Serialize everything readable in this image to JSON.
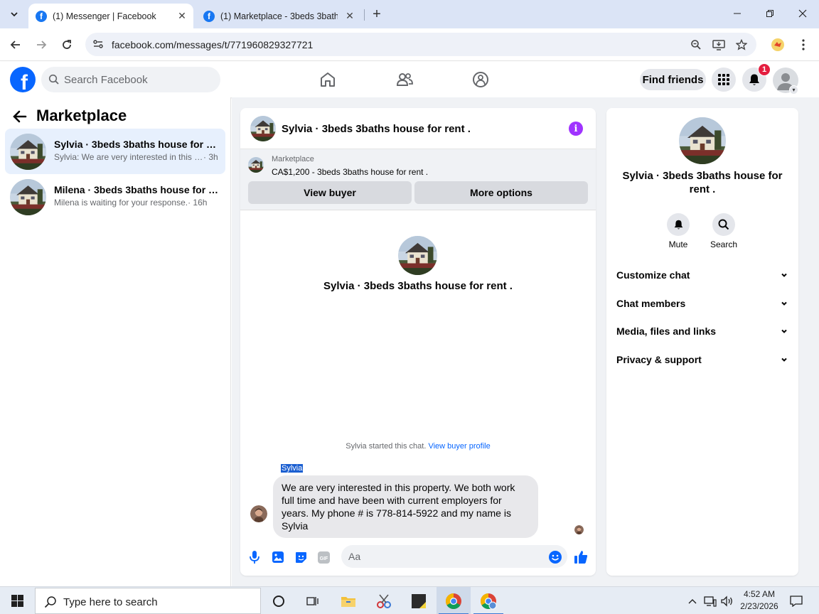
{
  "browser": {
    "tabs": [
      {
        "title": "(1) Messenger | Facebook",
        "active": true
      },
      {
        "title": "(1) Marketplace - 3beds 3baths",
        "active": false
      }
    ],
    "url": "facebook.com/messages/t/771960829327721"
  },
  "header": {
    "search_placeholder": "Search Facebook",
    "find_friends_label": "Find friends",
    "notification_count": "1"
  },
  "sidebar": {
    "title": "Marketplace",
    "conversations": [
      {
        "name": "Sylvia · 3beds 3baths house for rent .",
        "preview": "Sylvia: We are very interested in this property. We both work full time",
        "time": "· 3h"
      },
      {
        "name": "Milena · 3beds 3baths house for rent .",
        "preview": "Milena is waiting for your response.",
        "time": "· 16h"
      }
    ]
  },
  "chat": {
    "title": "Sylvia · 3beds 3baths house for rent .",
    "marketplace_label": "Marketplace",
    "listing": "CA$1,200 - 3beds 3baths house for rent .",
    "view_buyer_label": "View buyer",
    "more_options_label": "More options",
    "intro_name": "Sylvia · 3beds 3baths house for rent .",
    "started_text": "Sylvia started this chat.",
    "view_profile_link": "View buyer profile",
    "sender": "Sylvia",
    "message": "We are very interested in this property. We both work full time and have been with current employers for years. My phone # is 778-814-5922 and my name is Sylvia",
    "composer_placeholder": "Aa"
  },
  "details": {
    "name": "Sylvia · 3beds 3baths house for rent .",
    "actions": [
      {
        "label": "Mute"
      },
      {
        "label": "Search"
      }
    ],
    "sections": [
      "Customize chat",
      "Chat members",
      "Media, files and links",
      "Privacy & support"
    ]
  },
  "taskbar": {
    "search_placeholder": "Type here to search",
    "time": "4:52 AM",
    "date": "2/23/2026"
  },
  "colors": {
    "facebook_blue": "#0866ff",
    "info_purple": "#a033ff",
    "notification_red": "#e41e3f",
    "active_conversation": "#e7f0fd"
  }
}
